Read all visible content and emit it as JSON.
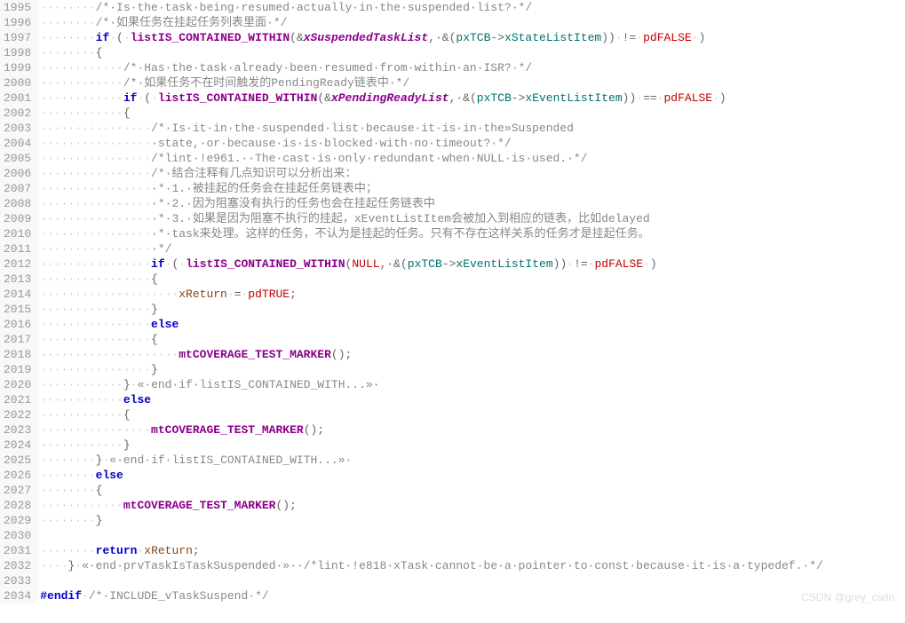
{
  "watermark": "CSDN @grey_csdn",
  "startLine": 1995,
  "lines": [
    {
      "i": 8,
      "t": [
        [
          "cmt",
          "/*·Is·the·task·being·resumed·actually·in·the·suspended·list?·*/"
        ]
      ]
    },
    {
      "i": 8,
      "t": [
        [
          "cmt",
          "/*·如果任务在挂起任务列表里面·*/"
        ]
      ]
    },
    {
      "i": 8,
      "t": [
        [
          "kw",
          "if"
        ],
        [
          "ws",
          "·"
        ],
        [
          "op",
          "("
        ],
        [
          "ws",
          "·"
        ],
        [
          "fn",
          "listIS_CONTAINED_WITHIN"
        ],
        [
          "op",
          "(&"
        ],
        [
          "var",
          "xSuspendedTaskList"
        ],
        [
          "op",
          ",·&("
        ],
        [
          "mem",
          "pxTCB"
        ],
        [
          "op",
          "->"
        ],
        [
          "mem",
          "xStateListItem"
        ],
        [
          "op",
          ")"
        ],
        [
          "op",
          ")"
        ],
        [
          "ws",
          "·"
        ],
        [
          "op",
          "!="
        ],
        [
          "ws",
          "·"
        ],
        [
          "const",
          "pdFALSE"
        ],
        [
          "ws",
          "·"
        ],
        [
          "op",
          ")"
        ]
      ]
    },
    {
      "i": 8,
      "t": [
        [
          "op",
          "{"
        ]
      ]
    },
    {
      "i": 12,
      "t": [
        [
          "cmt",
          "/*·Has·the·task·already·been·resumed·from·within·an·ISR?·*/"
        ]
      ]
    },
    {
      "i": 12,
      "t": [
        [
          "cmt",
          "/*·如果任务不在时间触发的PendingReady链表中·*/"
        ]
      ]
    },
    {
      "i": 12,
      "t": [
        [
          "kw",
          "if"
        ],
        [
          "ws",
          "·"
        ],
        [
          "op",
          "("
        ],
        [
          "ws",
          "·"
        ],
        [
          "fn",
          "listIS_CONTAINED_WITHIN"
        ],
        [
          "op",
          "(&"
        ],
        [
          "var",
          "xPendingReadyList"
        ],
        [
          "op",
          ",·&("
        ],
        [
          "mem",
          "pxTCB"
        ],
        [
          "op",
          "->"
        ],
        [
          "mem",
          "xEventListItem"
        ],
        [
          "op",
          ")"
        ],
        [
          "op",
          ")"
        ],
        [
          "ws",
          "·"
        ],
        [
          "op",
          "=="
        ],
        [
          "ws",
          "·"
        ],
        [
          "const",
          "pdFALSE"
        ],
        [
          "ws",
          "·"
        ],
        [
          "op",
          ")"
        ]
      ]
    },
    {
      "i": 12,
      "t": [
        [
          "op",
          "{"
        ]
      ]
    },
    {
      "i": 16,
      "t": [
        [
          "cmt",
          "/*·Is·it·in·the·suspended·list·because·it·is·in·the»Suspended"
        ]
      ]
    },
    {
      "i": 16,
      "t": [
        [
          "cmt",
          "·state,·or·because·is·is·blocked·with·no·timeout?·*/"
        ]
      ]
    },
    {
      "i": 16,
      "t": [
        [
          "cmt",
          "/*lint·!e961.··The·cast·is·only·redundant·when·NULL·is·used.·*/"
        ]
      ]
    },
    {
      "i": 16,
      "t": [
        [
          "cmt",
          "/*·结合注释有几点知识可以分析出来："
        ]
      ]
    },
    {
      "i": 16,
      "t": [
        [
          "cmt",
          "·*·1.·被挂起的任务会在挂起任务链表中；"
        ]
      ]
    },
    {
      "i": 16,
      "t": [
        [
          "cmt",
          "·*·2.·因为阻塞没有执行的任务也会在挂起任务链表中"
        ]
      ]
    },
    {
      "i": 16,
      "t": [
        [
          "cmt",
          "·*·3.·如果是因为阻塞不执行的挂起，xEventListItem会被加入到相应的链表，比如delayed"
        ]
      ]
    },
    {
      "i": 16,
      "t": [
        [
          "cmt",
          "·*·task来处理。这样的任务，不认为是挂起的任务。只有不存在这样关系的任务才是挂起任务。"
        ]
      ]
    },
    {
      "i": 16,
      "t": [
        [
          "cmt",
          "·*/"
        ]
      ]
    },
    {
      "i": 16,
      "t": [
        [
          "kw",
          "if"
        ],
        [
          "ws",
          "·"
        ],
        [
          "op",
          "("
        ],
        [
          "ws",
          "·"
        ],
        [
          "fn",
          "listIS_CONTAINED_WITHIN"
        ],
        [
          "op",
          "("
        ],
        [
          "const",
          "NULL"
        ],
        [
          "op",
          ",·&("
        ],
        [
          "mem",
          "pxTCB"
        ],
        [
          "op",
          "->"
        ],
        [
          "mem",
          "xEventListItem"
        ],
        [
          "op",
          ")"
        ],
        [
          "op",
          ")"
        ],
        [
          "ws",
          "·"
        ],
        [
          "op",
          "!="
        ],
        [
          "ws",
          "·"
        ],
        [
          "const",
          "pdFALSE"
        ],
        [
          "ws",
          "·"
        ],
        [
          "op",
          ")"
        ]
      ]
    },
    {
      "i": 16,
      "t": [
        [
          "op",
          "{"
        ]
      ]
    },
    {
      "i": 20,
      "t": [
        [
          "ret",
          "xReturn"
        ],
        [
          "ws",
          "·"
        ],
        [
          "op",
          "="
        ],
        [
          "ws",
          "·"
        ],
        [
          "const",
          "pdTRUE"
        ],
        [
          "op",
          ";"
        ]
      ]
    },
    {
      "i": 16,
      "t": [
        [
          "op",
          "}"
        ]
      ]
    },
    {
      "i": 16,
      "t": [
        [
          "kw",
          "else"
        ]
      ]
    },
    {
      "i": 16,
      "t": [
        [
          "op",
          "{"
        ]
      ]
    },
    {
      "i": 20,
      "t": [
        [
          "fn",
          "mtCOVERAGE_TEST_MARKER"
        ],
        [
          "op",
          "();"
        ]
      ]
    },
    {
      "i": 16,
      "t": [
        [
          "op",
          "}"
        ]
      ]
    },
    {
      "i": 12,
      "t": [
        [
          "op",
          "}"
        ],
        [
          "ws",
          "·"
        ],
        [
          "cmt",
          "«·end·if·listIS_CONTAINED_WITH...»·"
        ]
      ]
    },
    {
      "i": 12,
      "t": [
        [
          "kw",
          "else"
        ]
      ]
    },
    {
      "i": 12,
      "t": [
        [
          "op",
          "{"
        ]
      ]
    },
    {
      "i": 16,
      "t": [
        [
          "fn",
          "mtCOVERAGE_TEST_MARKER"
        ],
        [
          "op",
          "();"
        ]
      ]
    },
    {
      "i": 12,
      "t": [
        [
          "op",
          "}"
        ]
      ]
    },
    {
      "i": 8,
      "t": [
        [
          "op",
          "}"
        ],
        [
          "ws",
          "·"
        ],
        [
          "cmt",
          "«·end·if·listIS_CONTAINED_WITH...»·"
        ]
      ]
    },
    {
      "i": 8,
      "t": [
        [
          "kw",
          "else"
        ]
      ]
    },
    {
      "i": 8,
      "t": [
        [
          "op",
          "{"
        ]
      ]
    },
    {
      "i": 12,
      "t": [
        [
          "fn",
          "mtCOVERAGE_TEST_MARKER"
        ],
        [
          "op",
          "();"
        ]
      ]
    },
    {
      "i": 8,
      "t": [
        [
          "op",
          "}"
        ]
      ]
    },
    {
      "i": 0,
      "t": []
    },
    {
      "i": 8,
      "t": [
        [
          "kw",
          "return"
        ],
        [
          "ws",
          "·"
        ],
        [
          "ret",
          "xReturn"
        ],
        [
          "op",
          ";"
        ]
      ]
    },
    {
      "i": 4,
      "t": [
        [
          "op",
          "}"
        ],
        [
          "ws",
          "·"
        ],
        [
          "cmt",
          "«·end·prvTaskIsTaskSuspended·»··"
        ],
        [
          "cmt",
          "/*lint·!e818·xTask·cannot·be·a·pointer·to·const·because·it·is·a·typedef.·*/"
        ]
      ]
    },
    {
      "i": 0,
      "t": []
    },
    {
      "i": 0,
      "t": [
        [
          "pre",
          "#endif"
        ],
        [
          "ws",
          "·"
        ],
        [
          "cmt",
          "/*·INCLUDE_vTaskSuspend·*/"
        ]
      ]
    }
  ]
}
